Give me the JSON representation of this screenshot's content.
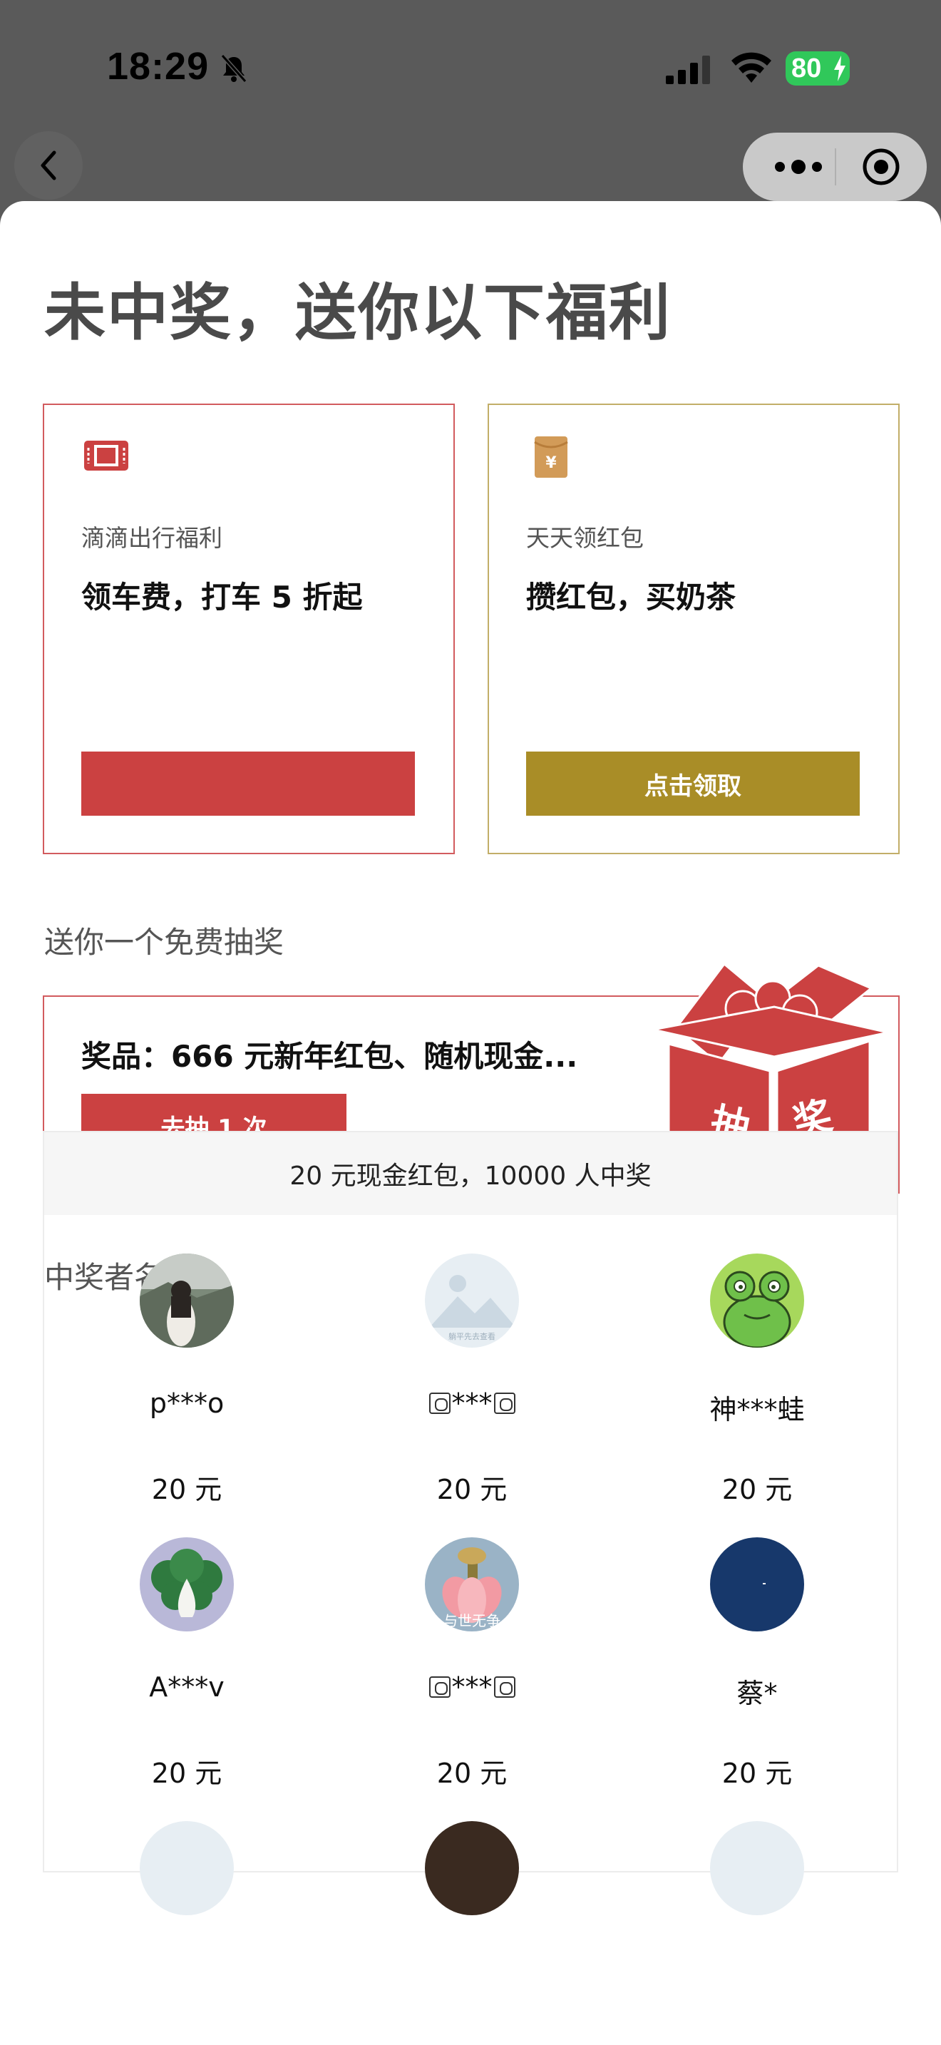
{
  "status_bar": {
    "time": "18:29",
    "battery": "80"
  },
  "title": "未中奖，送你以下福利",
  "cards": [
    {
      "label": "滴滴出行福利",
      "headline": "领车费，打车 5 折起",
      "cta": "",
      "icon": "ticket-icon",
      "accent": "#cb4141"
    },
    {
      "label": "天天领红包",
      "headline": "攒红包，买奶茶",
      "cta": "点击领取",
      "icon": "red-envelope-icon",
      "accent": "#a98d27"
    }
  ],
  "lottery": {
    "section_label": "送你一个免费抽奖",
    "prize": "奖品：666 元新年红包、随机现金...",
    "button": "去抽 1 次",
    "box_chars": [
      "抽",
      "奖"
    ]
  },
  "winners": {
    "section_label": "中奖者名单",
    "header": "20 元现金红包，10000 人中奖",
    "list": [
      {
        "prefix": "p",
        "suffix": "o",
        "masked": "***",
        "amount": "20 元",
        "avatar": "avatar-photo"
      },
      {
        "prefix": "",
        "suffix": "",
        "masked": "***",
        "amount": "20 元",
        "avatar": "avatar-mountain",
        "box_glyphs": true
      },
      {
        "prefix": "神",
        "suffix": "蛙",
        "masked": "***",
        "amount": "20 元",
        "avatar": "avatar-frog"
      },
      {
        "prefix": "A",
        "suffix": "v",
        "masked": "***",
        "amount": "20 元",
        "avatar": "avatar-cabbage"
      },
      {
        "prefix": "",
        "suffix": "",
        "masked": "***",
        "amount": "20 元",
        "avatar": "avatar-lotus",
        "box_glyphs": true
      },
      {
        "prefix": "蔡",
        "suffix": "",
        "masked": "*",
        "amount": "20 元",
        "avatar": "avatar-navy"
      }
    ],
    "avatar_texts": {
      "mountain": "躺平先去查看",
      "lotus": "与世无争"
    }
  },
  "colors": {
    "red": "#cb4141",
    "gold": "#a98d27",
    "battery_green": "#30c85a"
  }
}
